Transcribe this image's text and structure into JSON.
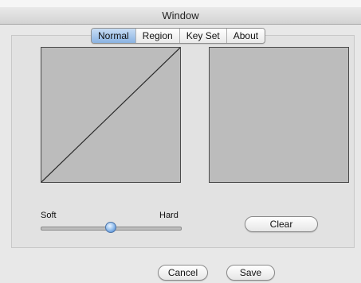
{
  "window": {
    "title": "Window"
  },
  "tabs": [
    {
      "label": "Normal",
      "selected": true
    },
    {
      "label": "Region",
      "selected": false
    },
    {
      "label": "Key Set",
      "selected": false
    },
    {
      "label": "About",
      "selected": false
    }
  ],
  "slider": {
    "min_label": "Soft",
    "max_label": "Hard",
    "value_fraction": 0.5
  },
  "buttons": {
    "clear": "Clear",
    "cancel": "Cancel",
    "save": "Save"
  },
  "colors": {
    "canvas": "#bcbcbc",
    "selected_tab": "#9dbfe8",
    "accent": "#3d7ccb"
  }
}
